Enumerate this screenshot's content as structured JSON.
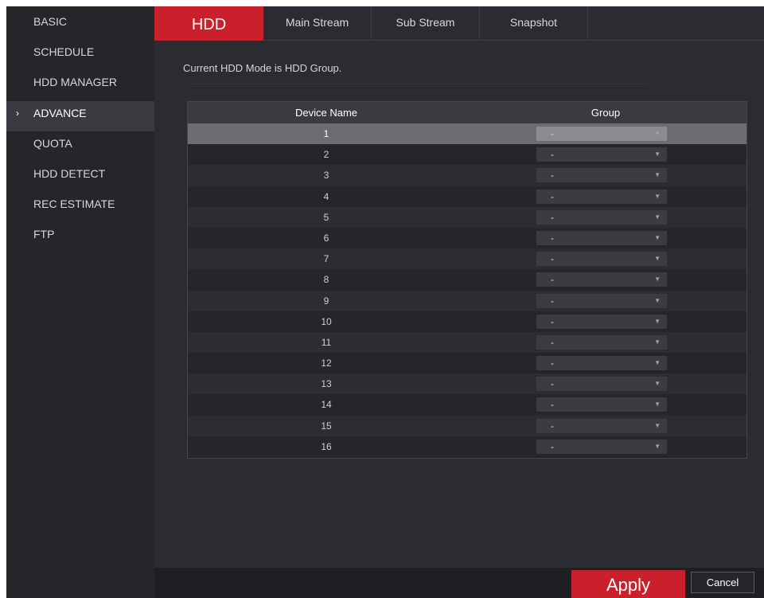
{
  "sidebar": {
    "items": [
      {
        "label": "BASIC"
      },
      {
        "label": "SCHEDULE"
      },
      {
        "label": "HDD MANAGER"
      },
      {
        "label": "ADVANCE",
        "active": true
      },
      {
        "label": "QUOTA"
      },
      {
        "label": "HDD DETECT"
      },
      {
        "label": "REC ESTIMATE"
      },
      {
        "label": "FTP"
      }
    ],
    "active_marker": "›"
  },
  "tabs": [
    {
      "label": "HDD",
      "active": true
    },
    {
      "label": "Main Stream"
    },
    {
      "label": "Sub Stream"
    },
    {
      "label": "Snapshot"
    }
  ],
  "main": {
    "mode_text": "Current HDD Mode is HDD Group."
  },
  "table": {
    "columns": [
      "Device Name",
      "Group"
    ],
    "rows": [
      {
        "name": "1",
        "group": "-",
        "selected": true
      },
      {
        "name": "2",
        "group": "-"
      },
      {
        "name": "3",
        "group": "-"
      },
      {
        "name": "4",
        "group": "-"
      },
      {
        "name": "5",
        "group": "-"
      },
      {
        "name": "6",
        "group": "-"
      },
      {
        "name": "7",
        "group": "-"
      },
      {
        "name": "8",
        "group": "-"
      },
      {
        "name": "9",
        "group": "-"
      },
      {
        "name": "10",
        "group": "-"
      },
      {
        "name": "11",
        "group": "-"
      },
      {
        "name": "12",
        "group": "-"
      },
      {
        "name": "13",
        "group": "-"
      },
      {
        "name": "14",
        "group": "-"
      },
      {
        "name": "15",
        "group": "-"
      },
      {
        "name": "16",
        "group": "-"
      }
    ],
    "dropdown_icon": "chevron-down-icon"
  },
  "footer": {
    "apply_label": "Apply",
    "cancel_label": "Cancel"
  },
  "colors": {
    "accent": "#c9202b",
    "background": "#2b2c31",
    "sidebar": "#25262a"
  }
}
